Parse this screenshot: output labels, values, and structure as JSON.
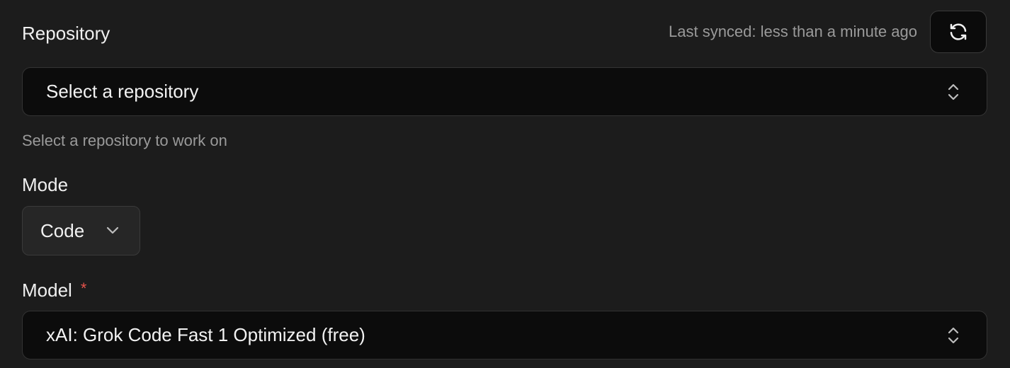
{
  "repository": {
    "label": "Repository",
    "last_synced": "Last synced: less than a minute ago",
    "refresh_icon": "refresh-icon",
    "select_value": "Select a repository",
    "help_text": "Select a repository to work on"
  },
  "mode": {
    "label": "Mode",
    "value": "Code"
  },
  "model": {
    "label": "Model",
    "required_marker": "*",
    "value": "xAI: Grok Code Fast 1 Optimized (free)"
  },
  "colors": {
    "required": "#e5534b",
    "background": "#1c1c1c",
    "field_background": "#0c0c0c"
  }
}
